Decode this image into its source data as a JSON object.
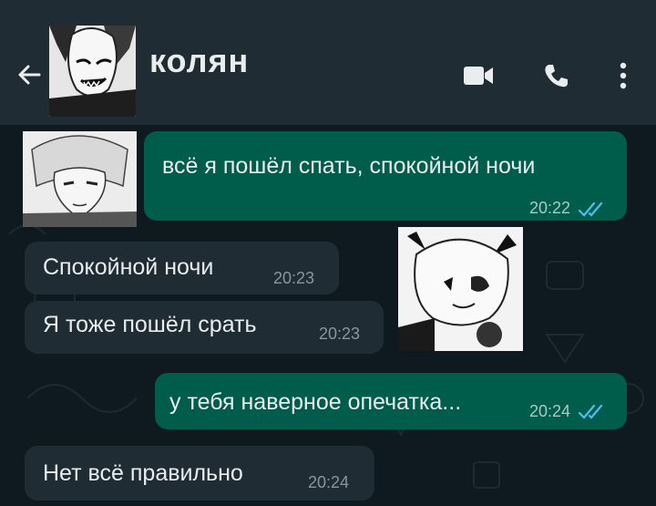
{
  "header": {
    "contact_name": "колян"
  },
  "messages": [
    {
      "direction": "outgoing",
      "text": "всё я пошёл спать, спокойной ночи",
      "time": "20:22",
      "status": "read"
    },
    {
      "direction": "incoming",
      "text": "Спокойной ночи",
      "time": "20:23"
    },
    {
      "direction": "incoming",
      "text": "Я тоже пошёл срать",
      "time": "20:23"
    },
    {
      "direction": "outgoing",
      "text": "у тебя наверное опечатка...",
      "time": "20:24",
      "status": "read"
    },
    {
      "direction": "incoming",
      "text": "Нет всё правильно",
      "time": "20:24"
    }
  ],
  "colors": {
    "header_bg": "#1f2c34",
    "chat_bg": "#0e1a20",
    "outgoing_bubble": "#005c4b",
    "incoming_bubble": "#202c33",
    "read_ticks": "#53bdeb"
  }
}
